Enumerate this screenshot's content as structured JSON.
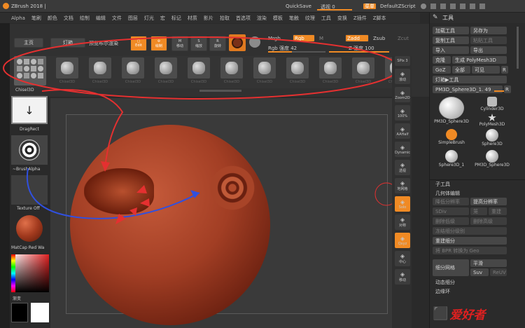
{
  "titlebar": {
    "app_title": "ZBrush 2018 |",
    "quicksave": "QuickSave",
    "transparency_label": "透视 0",
    "menus_label": "菜单",
    "script_label": "DefaultZScript"
  },
  "menubar": [
    "Alpha",
    "笔刷",
    "颜色",
    "文档",
    "绘制",
    "编辑",
    "文件",
    "图层",
    "灯光",
    "宏",
    "标记",
    "材质",
    "影片",
    "拾取",
    "首选项",
    "渲染",
    "模板",
    "笔触",
    "纹理",
    "工具",
    "变换",
    "Z插件",
    "Z脚本"
  ],
  "toolbar": {
    "home": "主页",
    "lightbox": "灯箱",
    "preview_render": "预览布尔渲染",
    "edit": "Edit",
    "draw": "绘制",
    "move": "移动",
    "scale": "缩放",
    "rotate": "旋转",
    "mrgb": "Mrgb",
    "rgb": "Rgb",
    "m": "M",
    "zadd": "Zadd",
    "zsub": "Zsub",
    "zcut": "Zcut",
    "rgb_intensity": "Rgb 强度 42",
    "z_intensity": "Z 强度 100"
  },
  "leftshelf": {
    "chisel": "Chisel3D",
    "dragrect": "DragRect",
    "alpha": "~BrushAlpha",
    "texture": "Texture Off",
    "matcap": "MatCap Red Wa",
    "gradient": "渐变"
  },
  "brushes": [
    "Chisel3D",
    "Chisel3D",
    "Chisel3D",
    "Chisel3D",
    "Chisel3D",
    "Chisel3D",
    "Chisel3D",
    "Chisel3D",
    "Chisel3D",
    "Chisel3D",
    "Chisel3D"
  ],
  "rightshelf": {
    "spix": "SPix 3",
    "scroll": "滚动",
    "zoom2d": "Zoom2D",
    "pct100": "100%",
    "aahalf": "AAHalf",
    "dynamic": "Dynamic",
    "persp": "透视",
    "floor": "地网格",
    "solo": "Solo",
    "transp": "对称",
    "xyz": "Qxyz",
    "frame": "中心",
    "move": "移动"
  },
  "tool_panel": {
    "title": "工具",
    "load": "加载工具",
    "save_as": "另存为",
    "copy": "复制工具",
    "paste": "粘贴工具",
    "import": "导入",
    "export": "导出",
    "clone": "克隆",
    "make_polymesh": "生成 PolyMesh3D",
    "goz": "GoZ",
    "all": "全部",
    "visible": "可见",
    "r": "R",
    "lightbox_tools": "灯箱▶工具",
    "current_tool": "PM3D_Sphere3D_1. 49",
    "tools": [
      {
        "name": "PM3D_Sphere3D"
      },
      {
        "name": "Cylinder3D"
      },
      {
        "name": "PolyMesh3D"
      },
      {
        "name": "SimpleBrush"
      },
      {
        "name": "Sphere3D"
      },
      {
        "name": "Sphere3D_1"
      },
      {
        "name": "PM3D_Sphere3D"
      }
    ],
    "subtool": "子工具",
    "geometry": "几何体编辑",
    "lower_res": "降低分辨率",
    "higher_res": "提高分辨率",
    "sdiv": "SDiv",
    "cage": "笼",
    "rstr": "重建",
    "del_lower": "删除低级",
    "del_higher": "删除高级",
    "freeze": "冻结细分级别",
    "reconstruct": "重建细分",
    "bpr": "将 BPR 转换为 Geo",
    "divide_mesh": "细分网格",
    "smooth": "平滑",
    "suv": "Suv",
    "reluv": "ReUV",
    "dynamic_sub": "动态细分",
    "edge_loop": "边缘环"
  },
  "watermark": "爱好者"
}
